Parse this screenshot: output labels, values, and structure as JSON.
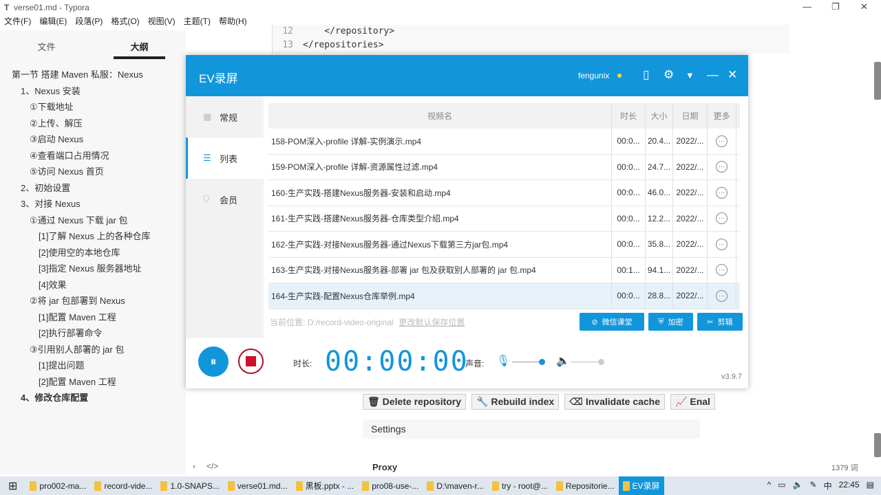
{
  "window": {
    "title": "verse01.md - Typora",
    "app_icon": "T"
  },
  "menu": [
    "文件(F)",
    "编辑(E)",
    "段落(P)",
    "格式(O)",
    "视图(V)",
    "主题(T)",
    "帮助(H)"
  ],
  "sidebar": {
    "tabs": [
      "文件",
      "大纲"
    ],
    "outline": [
      {
        "t": "第一节 搭建 Maven 私服：Nexus",
        "l": 1
      },
      {
        "t": "1、Nexus 安装",
        "l": 2
      },
      {
        "t": "①下载地址",
        "l": 3
      },
      {
        "t": "②上传、解压",
        "l": 3
      },
      {
        "t": "③启动 Nexus",
        "l": 3
      },
      {
        "t": "④查看端口占用情况",
        "l": 3
      },
      {
        "t": "⑤访问 Nexus 首页",
        "l": 3
      },
      {
        "t": "2、初始设置",
        "l": 2
      },
      {
        "t": "3、对接 Nexus",
        "l": 2
      },
      {
        "t": "①通过 Nexus 下载 jar 包",
        "l": 3
      },
      {
        "t": "[1]了解 Nexus 上的各种仓库",
        "l": 4
      },
      {
        "t": "[2]使用空的本地仓库",
        "l": 4
      },
      {
        "t": "[3]指定 Nexus 服务器地址",
        "l": 4
      },
      {
        "t": "[4]效果",
        "l": 4
      },
      {
        "t": "②将 jar 包部署到 Nexus",
        "l": 3
      },
      {
        "t": "[1]配置 Maven 工程",
        "l": 4
      },
      {
        "t": "[2]执行部署命令",
        "l": 4
      },
      {
        "t": "③引用别人部署的 jar 包",
        "l": 3
      },
      {
        "t": "[1]提出问题",
        "l": 4
      },
      {
        "t": "[2]配置 Maven 工程",
        "l": 4
      },
      {
        "t": "4、修改仓库配置",
        "l": 2,
        "bold": true
      }
    ]
  },
  "editor": {
    "lines": [
      {
        "n": "12",
        "code": "    </repository>"
      },
      {
        "n": "13",
        "code": "</repositories>"
      }
    ],
    "nexus_buttons": [
      "Delete repository",
      "Rebuild index",
      "Invalidate cache",
      "Enal"
    ],
    "settings": "Settings",
    "proxy": "Proxy",
    "word_count": "1379 词"
  },
  "ev": {
    "title": "EV录屏",
    "user": "fengunix",
    "nav": [
      {
        "label": "常规",
        "icon": "grid-icon"
      },
      {
        "label": "列表",
        "icon": "list-icon",
        "active": true
      },
      {
        "label": "会员",
        "icon": "shield-icon"
      }
    ],
    "columns": [
      "视频名",
      "时长",
      "大小",
      "日期",
      "更多"
    ],
    "rows": [
      {
        "name": "158-POM深入-profile 详解-实例演示.mp4",
        "dur": "00:0...",
        "size": "20.4...",
        "date": "2022/..."
      },
      {
        "name": "159-POM深入-profile 详解-资源属性过滤.mp4",
        "dur": "00:0...",
        "size": "24.7...",
        "date": "2022/..."
      },
      {
        "name": "160-生产实践-搭建Nexus服务器-安装和启动.mp4",
        "dur": "00:0...",
        "size": "46.0...",
        "date": "2022/..."
      },
      {
        "name": "161-生产实践-搭建Nexus服务器-仓库类型介绍.mp4",
        "dur": "00:0...",
        "size": "12.2...",
        "date": "2022/..."
      },
      {
        "name": "162-生产实践-对接Nexus服务器-通过Nexus下载第三方jar包.mp4",
        "dur": "00:0...",
        "size": "35.8...",
        "date": "2022/..."
      },
      {
        "name": "163-生产实践-对接Nexus服务器-部署 jar 包及获取别人部署的 jar 包.mp4",
        "dur": "00:1...",
        "size": "94.1...",
        "date": "2022/..."
      },
      {
        "name": "164-生产实践-配置Nexus仓库举例.mp4",
        "dur": "00:0...",
        "size": "28.8...",
        "date": "2022/...",
        "selected": true
      }
    ],
    "location_label": "当前位置:",
    "location": "D:/record-video-original",
    "change_location": "更改默认保存位置",
    "buttons": [
      "微信课堂",
      "加密",
      "剪辑"
    ],
    "duration_label": "时长:",
    "timer": "00:00:00",
    "sound_label": "声音:",
    "version": "v3.9.7",
    "mic_level": 0.9,
    "speaker_level": 0.9
  },
  "taskbar": {
    "items": [
      "pro002-ma...",
      "record-vide...",
      "1.0-SNAPS...",
      "verse01.md...",
      "黑板.pptx - ...",
      "pro08-use-...",
      "D:\\maven-r...",
      "try - root@...",
      "Repositorie...",
      "EV录屏"
    ],
    "time": "22:45",
    "ime": "中"
  }
}
